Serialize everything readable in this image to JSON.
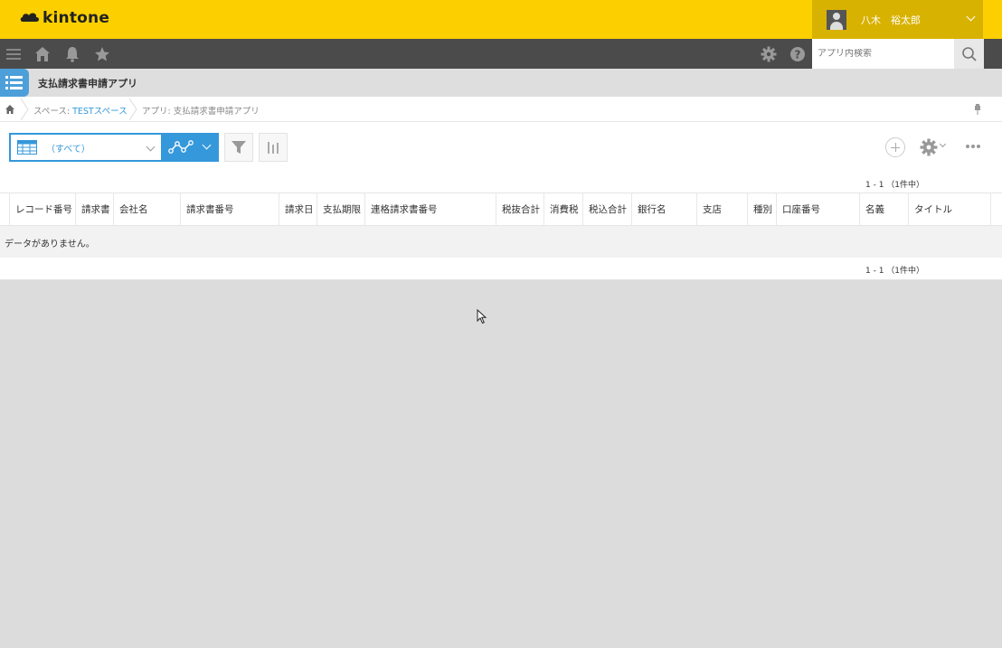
{
  "header": {
    "logo_text": "kintone",
    "user_name": "八木　裕太郎"
  },
  "navbar": {
    "search_placeholder": "アプリ内検索"
  },
  "app": {
    "title": "支払請求書申請アプリ"
  },
  "breadcrumb": {
    "space_prefix": "スペース: ",
    "space_name": "TESTスペース",
    "app_crumb": "アプリ: 支払請求書申請アプリ"
  },
  "toolbar": {
    "view_label": "（すべて）",
    "pager_top": "1 - 1 （1件中）",
    "pager_bottom": "1 - 1 （1件中）"
  },
  "table": {
    "columns": [
      "レコード番号",
      "請求書",
      "会社名",
      "請求書番号",
      "請求日",
      "支払期限",
      "連格請求書番号",
      "税抜合計",
      "消費税",
      "税込合計",
      "銀行名",
      "支店",
      "種別",
      "口座番号",
      "名義",
      "タイトル"
    ],
    "empty_message": "データがありません。"
  },
  "colors": {
    "header_yellow": "#fcd000",
    "navbar": "#4b4b4b",
    "accent_blue": "#3498db"
  }
}
